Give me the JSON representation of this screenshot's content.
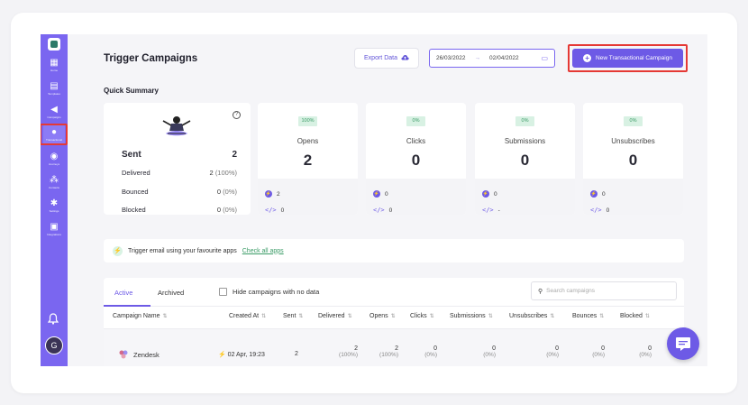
{
  "sidebar": {
    "items": [
      {
        "label": "Home",
        "icon": "grid-icon"
      },
      {
        "label": "Templates",
        "icon": "template-icon"
      },
      {
        "label": "Campaigns",
        "icon": "megaphone-icon"
      },
      {
        "label": "Transactional",
        "icon": "transactional-icon"
      },
      {
        "label": "Journeys",
        "icon": "journeys-icon"
      },
      {
        "label": "Contacts",
        "icon": "contacts-icon"
      },
      {
        "label": "Settings",
        "icon": "gear-icon"
      },
      {
        "label": "Integrations",
        "icon": "integrations-icon"
      }
    ],
    "avatar": "G"
  },
  "header": {
    "title": "Trigger Campaigns",
    "export_label": "Export Data",
    "date_from": "26/03/2022",
    "date_to": "02/04/2022",
    "new_campaign_label": "New Transactional Campaign"
  },
  "summary": {
    "title": "Quick Summary",
    "sent_label": "Sent",
    "sent_value": "2",
    "delivered_label": "Delivered",
    "delivered_value": "2",
    "delivered_pct": "(100%)",
    "bounced_label": "Bounced",
    "bounced_value": "0",
    "bounced_pct": "(0%)",
    "blocked_label": "Blocked",
    "blocked_value": "0",
    "blocked_pct": "(0%)",
    "stats": [
      {
        "label": "Opens",
        "pct": "100%",
        "value": "2",
        "zap": "2",
        "code": "0"
      },
      {
        "label": "Clicks",
        "pct": "0%",
        "value": "0",
        "zap": "0",
        "code": "0"
      },
      {
        "label": "Submissions",
        "pct": "0%",
        "value": "0",
        "zap": "0",
        "code": "-"
      },
      {
        "label": "Unsubscribes",
        "pct": "0%",
        "value": "0",
        "zap": "0",
        "code": "0"
      }
    ]
  },
  "trigger_bar": {
    "text": "Trigger email using your favourite apps",
    "link": "Check all apps"
  },
  "table": {
    "tabs": [
      "Active",
      "Archived"
    ],
    "hide_label": "Hide campaigns with no data",
    "search_placeholder": "Search campaigns",
    "columns": [
      "Campaign Name",
      "Created At",
      "Sent",
      "Delivered",
      "Opens",
      "Clicks",
      "Submissions",
      "Unsubscribes",
      "Bounces",
      "Blocked"
    ],
    "rows": [
      {
        "name": "Zendesk",
        "created": "02 Apr, 19:23",
        "sent": "2",
        "delivered": "2",
        "delivered_pct": "(100%)",
        "opens": "2",
        "opens_pct": "(100%)",
        "clicks": "0",
        "clicks_pct": "(0%)",
        "submissions": "0",
        "submissions_pct": "(0%)",
        "unsubscribes": "0",
        "unsubscribes_pct": "(0%)",
        "bounces": "0",
        "bounces_pct": "(0%)",
        "blocked": "0",
        "blocked_pct": "(0%)"
      }
    ]
  },
  "colors": {
    "accent": "#6d5ae6",
    "sidebar": "#7a66f0",
    "highlight": "#e53935",
    "success": "#3a9b66"
  }
}
